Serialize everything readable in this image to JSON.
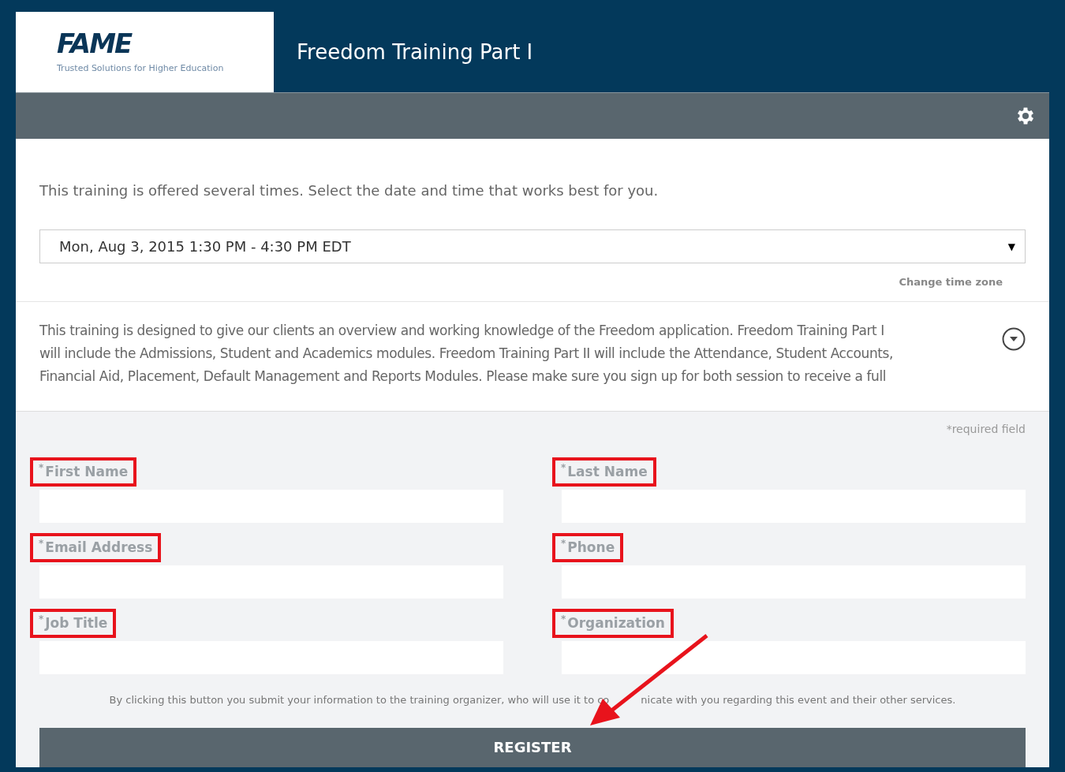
{
  "header": {
    "logo": {
      "wordmark": "FAME",
      "tagline": "Trusted Solutions for Higher Education"
    },
    "title": "Freedom Training Part I"
  },
  "intro": "This training is offered several times. Select the date and time that works best for you.",
  "session_select": {
    "value": "Mon, Aug 3, 2015 1:30 PM - 4:30 PM EDT",
    "arrow": "▼"
  },
  "change_time_zone": "Change time zone",
  "description": {
    "lines": [
      "This training is designed to give our clients an overview and working knowledge of the Freedom application. Freedom Training Part I",
      "will include the Admissions, Student and Academics modules. Freedom Training Part II will include the Attendance, Student Accounts,",
      "Financial Aid, Placement, Default Management and Reports Modules. Please make sure you sign up for both session to receive a full"
    ],
    "expanded": false
  },
  "required_note": "*required field",
  "fields": [
    {
      "marker": "*",
      "label": "First Name",
      "highlighted": true
    },
    {
      "marker": "*",
      "label": "Last Name",
      "highlighted": true
    },
    {
      "marker": "*",
      "label": "Email Address",
      "highlighted": true
    },
    {
      "marker": "*",
      "label": "Phone",
      "highlighted": true
    },
    {
      "marker": "*",
      "label": "Job Title",
      "highlighted": true
    },
    {
      "marker": "*",
      "label": "Organization",
      "highlighted": true
    }
  ],
  "consent": [
    "By clicking this button you submit your information to the training organizer, who will use it to co",
    "nicate with you regarding this event and their other services."
  ],
  "register_button": "REGISTER"
}
